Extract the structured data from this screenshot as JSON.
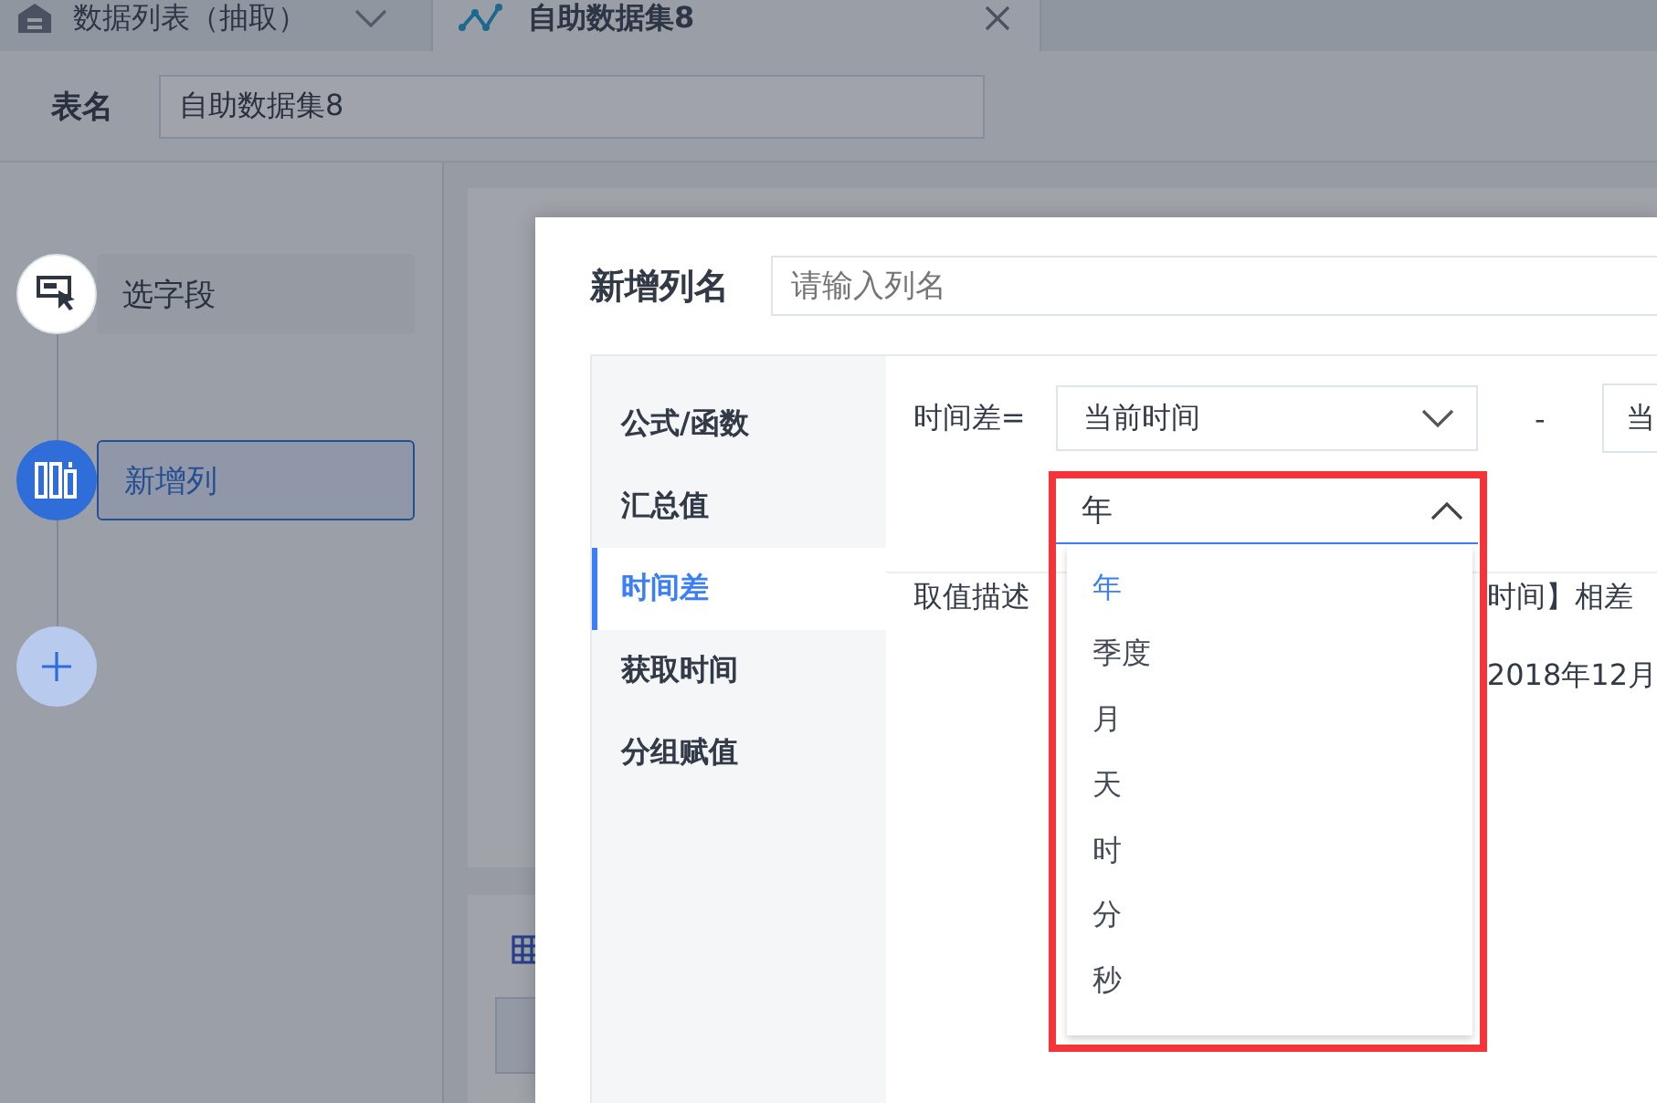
{
  "tabs": [
    {
      "label": "数据列表（抽取）",
      "selected": false,
      "kind": "home"
    },
    {
      "label": "自助数据集8",
      "selected": true,
      "kind": "chart"
    }
  ],
  "table_name": {
    "label": "表名",
    "value": "自助数据集8"
  },
  "steps": [
    {
      "label": "选字段",
      "selected": false,
      "kind": "select-field"
    },
    {
      "label": "新增列",
      "selected": true,
      "kind": "add-column"
    }
  ],
  "modal": {
    "name_label": "新增列名",
    "name_field": {
      "placeholder": "请输入列名"
    },
    "menu": [
      {
        "label": "公式/函数",
        "selected": false
      },
      {
        "label": "汇总值",
        "selected": false
      },
      {
        "label": "时间差",
        "selected": true
      },
      {
        "label": "获取时间",
        "selected": false
      },
      {
        "label": "分组赋值",
        "selected": false
      }
    ],
    "formula_label": "时间差=",
    "start_select": {
      "value": "当前时间"
    },
    "minus": "-",
    "end_select": {
      "value": "当"
    },
    "unit_select": {
      "value": "年",
      "expanded": true
    },
    "unit_options": [
      {
        "label": "年",
        "selected": true
      },
      {
        "label": "季度",
        "selected": false
      },
      {
        "label": "月",
        "selected": false
      },
      {
        "label": "天",
        "selected": false
      },
      {
        "label": "时",
        "selected": false
      },
      {
        "label": "分",
        "selected": false
      },
      {
        "label": "秒",
        "selected": false
      }
    ],
    "description_label": "取值描述",
    "description_text": "时间】相差",
    "example_text": "2018年12月"
  }
}
